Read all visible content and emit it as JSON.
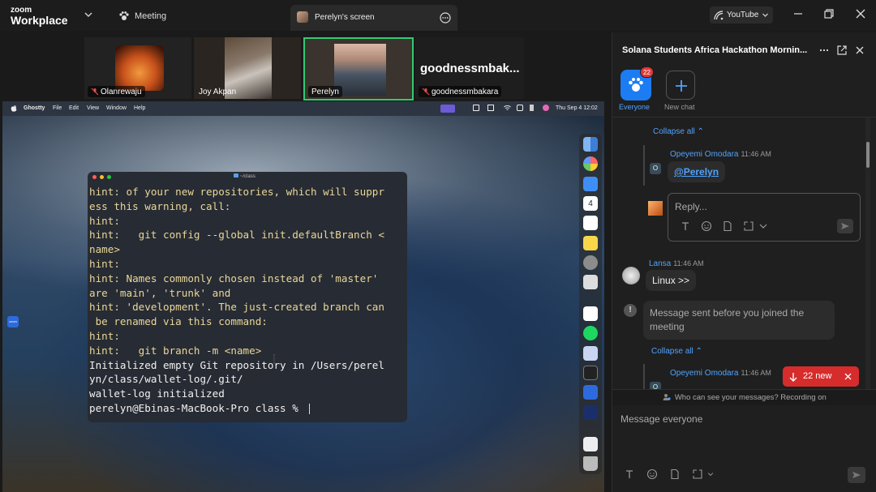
{
  "topbar": {
    "brand_line1": "zoom",
    "brand_line2": "Workplace",
    "meeting_label": "Meeting",
    "screen_tab_title": "Perelyn's screen",
    "youtube_label": "YouTube"
  },
  "thumbnails": [
    {
      "name": "Olanrewaju",
      "muted": true
    },
    {
      "name": "Joy Akpan",
      "muted": false
    },
    {
      "name": "Perelyn",
      "muted": false,
      "active_speaker": true
    },
    {
      "name": "goodnessmbakara",
      "big_name": "goodnessmbak...",
      "muted": true
    }
  ],
  "mac": {
    "app": "Ghostty",
    "menu": [
      "File",
      "Edit",
      "View",
      "Window",
      "Help"
    ],
    "clock": "Thu Sep 4  12:02",
    "calendar_day": "4",
    "zoom_label": "zoom"
  },
  "terminal": {
    "title": "~/class",
    "lines": [
      {
        "text": "hint: of your new repositories, which will suppr",
        "kind": "hint"
      },
      {
        "text": "ess this warning, call:",
        "kind": "hint"
      },
      {
        "text": "hint:",
        "kind": "hint"
      },
      {
        "text": "hint:   git config --global init.defaultBranch <",
        "kind": "hint"
      },
      {
        "text": "name>",
        "kind": "hint"
      },
      {
        "text": "hint:",
        "kind": "hint"
      },
      {
        "text": "hint: Names commonly chosen instead of 'master'",
        "kind": "hint"
      },
      {
        "text": "are 'main', 'trunk' and",
        "kind": "hint"
      },
      {
        "text": "hint: 'development'. The just-created branch can",
        "kind": "hint"
      },
      {
        "text": " be renamed via this command:",
        "kind": "hint"
      },
      {
        "text": "hint:",
        "kind": "hint"
      },
      {
        "text": "hint:   git branch -m <name>",
        "kind": "hint"
      },
      {
        "text": "Initialized empty Git repository in /Users/perel",
        "kind": "plain"
      },
      {
        "text": "yn/class/wallet-log/.git/",
        "kind": "plain"
      },
      {
        "text": "wallet-log initialized",
        "kind": "plain"
      },
      {
        "text": "perelyn@Ebinas-MacBook-Pro class % ",
        "kind": "plain"
      }
    ]
  },
  "chat": {
    "title": "Solana Students Africa Hackathon Mornin...",
    "everyone_label": "Everyone",
    "everyone_badge": "22",
    "new_chat_label": "New chat",
    "collapse_all": "Collapse all",
    "msg1": {
      "author": "Opeyemi Omodara",
      "time": "11:46 AM",
      "avatar": "O",
      "text": "@Perelyn"
    },
    "reply_placeholder": "Reply...",
    "msg2": {
      "author": "Lansa",
      "time": "11:46 AM",
      "text": "Linux >>"
    },
    "system_msg": "Message sent before you joined the meeting",
    "msg3": {
      "author": "Opeyemi Omodara",
      "time": "11:46 AM",
      "avatar": "O"
    },
    "new_pill": "22 new",
    "who_can_see": "Who can see your messages? Recording on",
    "compose_placeholder": "Message everyone"
  },
  "colors": {
    "accent": "#1c7cf2",
    "link": "#4fa3ff",
    "alert": "#d62c2c",
    "speaker_border": "#2ecc71",
    "terminal_hint": "#e9d79a"
  }
}
